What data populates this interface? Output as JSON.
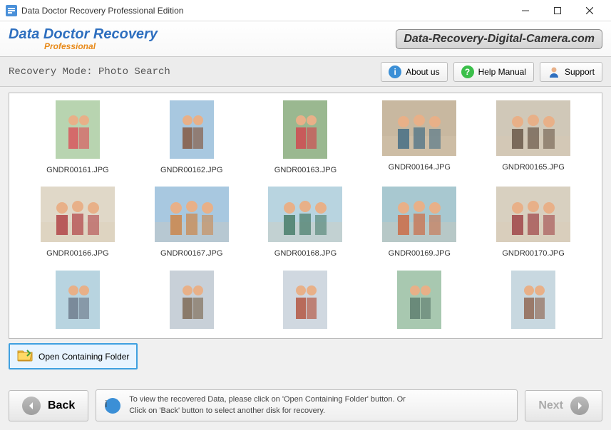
{
  "window": {
    "title": "Data Doctor Recovery Professional Edition"
  },
  "branding": {
    "main": "Data Doctor Recovery",
    "sub": "Professional",
    "url": "Data-Recovery-Digital-Camera.com"
  },
  "toolbar": {
    "mode_label": "Recovery Mode: Photo Search",
    "about": "About us",
    "help": "Help Manual",
    "support": "Support"
  },
  "thumbnails": [
    {
      "file": "GNDR00161.JPG",
      "orient": "portrait"
    },
    {
      "file": "GNDR00162.JPG",
      "orient": "portrait"
    },
    {
      "file": "GNDR00163.JPG",
      "orient": "portrait"
    },
    {
      "file": "GNDR00164.JPG",
      "orient": "landscape"
    },
    {
      "file": "GNDR00165.JPG",
      "orient": "landscape"
    },
    {
      "file": "GNDR00166.JPG",
      "orient": "landscape"
    },
    {
      "file": "GNDR00167.JPG",
      "orient": "landscape"
    },
    {
      "file": "GNDR00168.JPG",
      "orient": "landscape"
    },
    {
      "file": "GNDR00169.JPG",
      "orient": "landscape"
    },
    {
      "file": "GNDR00170.JPG",
      "orient": "landscape"
    },
    {
      "file": "",
      "orient": "portrait"
    },
    {
      "file": "",
      "orient": "portrait"
    },
    {
      "file": "",
      "orient": "portrait"
    },
    {
      "file": "",
      "orient": "portrait"
    },
    {
      "file": "",
      "orient": "portrait"
    }
  ],
  "actions": {
    "open_folder": "Open Containing Folder"
  },
  "hint": {
    "line1": "To view the recovered Data, please click on 'Open Containing Folder' button. Or",
    "line2": "Click on 'Back' button to select another disk for recovery."
  },
  "nav": {
    "back": "Back",
    "next": "Next"
  }
}
